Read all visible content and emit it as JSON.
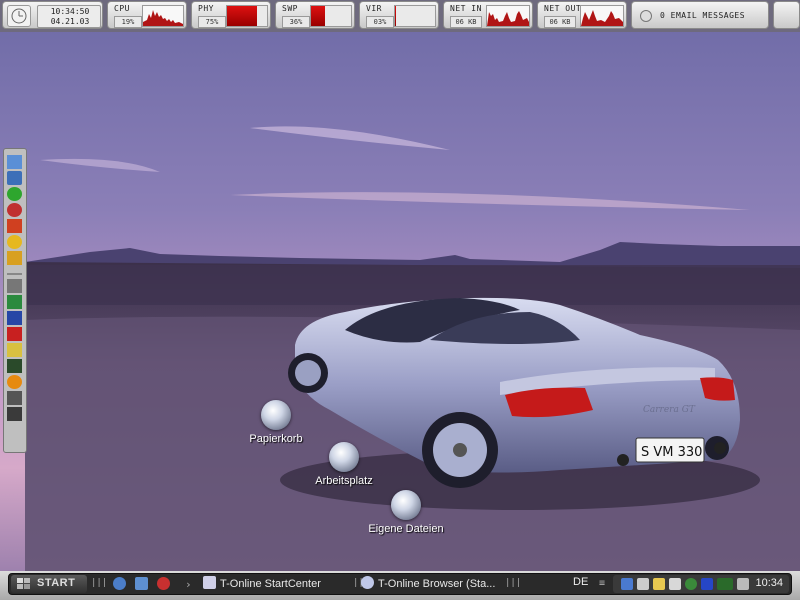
{
  "monitor_bar": {
    "clock": {
      "time": "10:34:50",
      "date": "04.21.03"
    },
    "cpu": {
      "label": "CPU",
      "value": "19%"
    },
    "phy": {
      "label": "PHY",
      "value": "75%",
      "fill": 0.75
    },
    "swp": {
      "label": "SWP",
      "value": "36%",
      "fill": 0.36
    },
    "vir": {
      "label": "VIR",
      "value": "03%",
      "fill": 0.03
    },
    "net_in": {
      "label": "NET IN",
      "value": "06 KB"
    },
    "net_out": {
      "label": "NET OUT",
      "value": "06 KB"
    },
    "email": {
      "text": "0 EMAIL MESSAGES"
    }
  },
  "desktop_icons": [
    {
      "label": "Papierkorb",
      "icon": "recycle-bin-icon"
    },
    {
      "label": "Arbeitsplatz",
      "icon": "my-computer-icon"
    },
    {
      "label": "Eigene Dateien",
      "icon": "my-documents-icon"
    }
  ],
  "wallpaper": {
    "plate": "S VM 330",
    "badge": "Carrera GT"
  },
  "taskbar": {
    "start_label": "START",
    "tasks": [
      {
        "label": "T-Online StartCenter",
        "icon": "t-online-icon"
      },
      {
        "label": "T-Online Browser (Sta...",
        "icon": "t-online-browser-icon"
      }
    ],
    "language": "DE",
    "clock": "10:34"
  },
  "colors": {
    "accent_red": "#cc1111",
    "taskbar_bg": "#2a2a2a",
    "monitor_bg": "#e0e0e0"
  }
}
